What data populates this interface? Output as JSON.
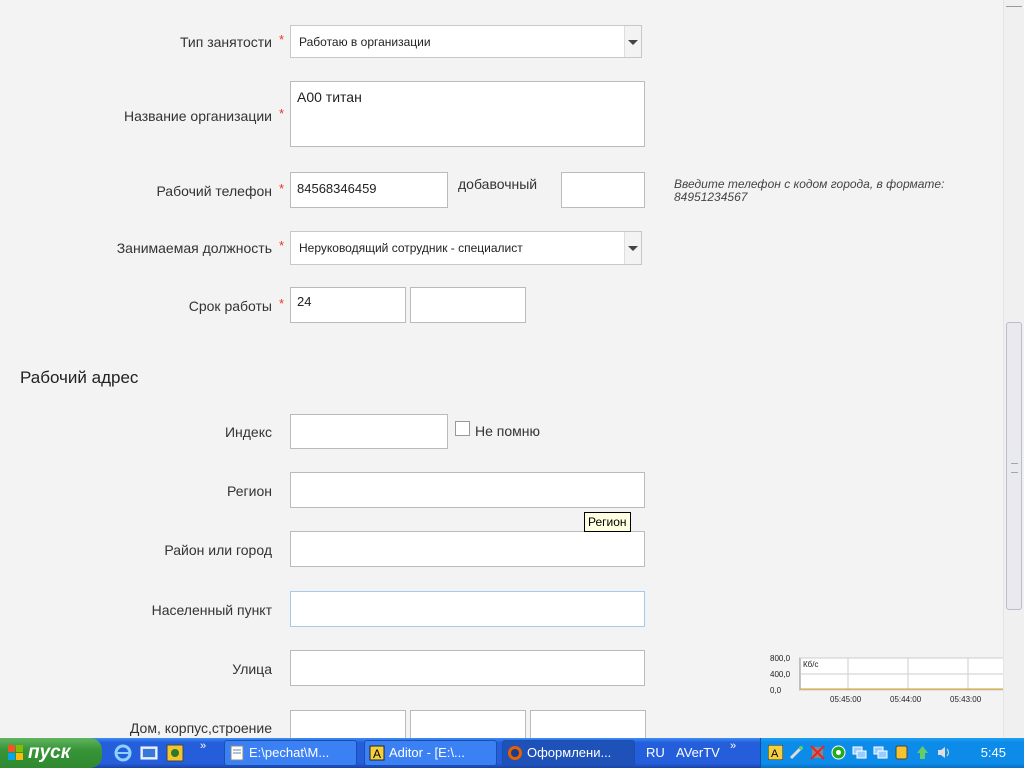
{
  "form": {
    "employment_type": {
      "label": "Тип занятости",
      "required": "*",
      "value": "Работаю в организации"
    },
    "org_name": {
      "label": "Название организации",
      "required": "*",
      "value": "А00 титан"
    },
    "work_phone": {
      "label": "Рабочий телефон",
      "required": "*",
      "value": "84568346459",
      "ext_label": "добавочный",
      "ext_value": "",
      "hint": "Введите телефон с кодом города, в формате: 84951234567"
    },
    "position": {
      "label": "Занимаемая должность",
      "required": "*",
      "value": "Неруководящий сотрудник - специалист"
    },
    "work_period": {
      "label": "Срок работы",
      "required": "*",
      "value1": "24",
      "value2": ""
    }
  },
  "address": {
    "section_title": "Рабочий адрес",
    "index": {
      "label": "Индекс",
      "value": "",
      "checkbox_label": "Не помню"
    },
    "region": {
      "label": "Регион",
      "value": "",
      "tooltip": "Регион"
    },
    "district": {
      "label": "Район или город",
      "value": ""
    },
    "locality": {
      "label": "Населенный пункт",
      "value": ""
    },
    "street": {
      "label": "Улица",
      "value": ""
    },
    "house": {
      "label": "Дом, корпус,строение"
    }
  },
  "chart_data": {
    "type": "line",
    "title": "",
    "ylabel": "Кб/с",
    "yticks": [
      "800,0",
      "400,0",
      "0,0"
    ],
    "xticks": [
      "05:45:00",
      "05:44:00",
      "05:43:00"
    ],
    "ylim": [
      0,
      800
    ],
    "series": [
      {
        "values": [
          0,
          0,
          0,
          0,
          0,
          0,
          0
        ]
      }
    ]
  },
  "taskbar": {
    "start_label": "пуск",
    "chevron": "»",
    "tasks": [
      {
        "label": "E:\\pechat\\M..."
      },
      {
        "label": "Aditor - [E:\\..."
      },
      {
        "label": "Оформлени..."
      }
    ],
    "lang": "RU",
    "avertv": "AVerTV",
    "clock": "5:45"
  },
  "colors": {
    "required": "#e32222",
    "taskbar": "#245edb",
    "start": "#379437",
    "tooltip_bg": "#ffffe1"
  }
}
